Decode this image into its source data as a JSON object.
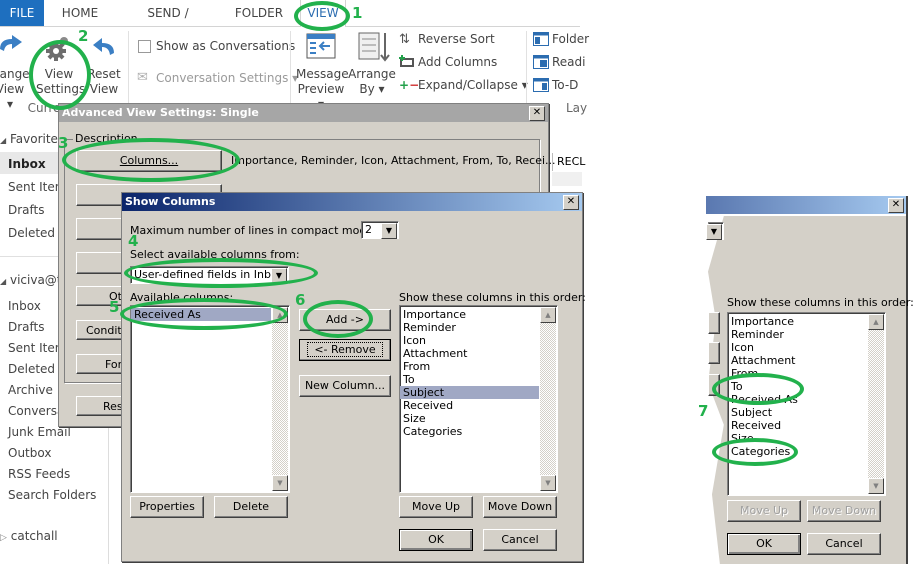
{
  "ribbon": {
    "tabs": [
      "FILE",
      "HOME",
      "SEND / RECEIVE",
      "FOLDER",
      "VIEW"
    ],
    "active_tab": "VIEW",
    "current_view_group": {
      "change_view": [
        "hange",
        "View ▾"
      ],
      "view_settings": [
        "View",
        "Settings"
      ],
      "reset_view": [
        "Reset",
        "View"
      ],
      "group_label": "Curre"
    },
    "messages_group": {
      "show_as_conversations": "Show as Conversations",
      "show_as_conversations_checked": false,
      "conversation_settings": "Conversation Settings ▾"
    },
    "arrangement_group": {
      "message_preview": [
        "Message",
        "Preview ▾"
      ],
      "arrange_by": [
        "Arrange",
        "By ▾"
      ],
      "reverse_sort": "Reverse Sort",
      "add_columns": "Add Columns",
      "expand_collapse": "Expand/Collapse ▾"
    },
    "layout_group": {
      "folder": "Folder",
      "reading": "Readi",
      "todo": "To-D",
      "group_label": "Lay"
    }
  },
  "nav": {
    "favorites_label": "Favorites",
    "favorites": [
      "Inbox",
      "Sent Item",
      "Drafts",
      "Deleted It"
    ],
    "account_label": "viciva@t",
    "account_folders": [
      "Inbox",
      "Drafts",
      "Sent Item",
      "Deleted It",
      "Archive",
      "Conversa",
      "Junk Email",
      "Outbox",
      "RSS Feeds",
      "Search Folders"
    ],
    "other_account": "catchall"
  },
  "message_list": {
    "column_header_partial": "RECL"
  },
  "advanced_view_settings": {
    "title": "Advanced View Settings: Single",
    "description_label": "Description",
    "columns_button": "Columns...",
    "columns_value": "Importance, Reminder, Icon, Attachment, From, To, Recei...",
    "other_button_partial": "Ot",
    "conditional_button_partial": "Condit",
    "format_button_partial": "For",
    "reset_button_partial": "Rese"
  },
  "show_columns": {
    "title": "Show Columns",
    "max_lines_label": "Maximum number of lines in compact mode:",
    "max_lines_value": "2",
    "select_from_label": "Select available columns from:",
    "select_from_value": "User-defined fields in Inbc",
    "available_label": "Available columns:",
    "available_columns": [
      "Received As"
    ],
    "available_selected": "Received As",
    "add_button": "Add ->",
    "remove_button": "<- Remove",
    "new_column_button": "New Column...",
    "properties_button": "Properties",
    "delete_button": "Delete",
    "order_label": "Show these columns in this order:",
    "order_columns": [
      "Importance",
      "Reminder",
      "Icon",
      "Attachment",
      "From",
      "To",
      "Subject",
      "Received",
      "Size",
      "Categories"
    ],
    "order_selected": "Subject",
    "move_up_button": "Move Up",
    "move_down_button": "Move Down",
    "ok_button": "OK",
    "cancel_button": "Cancel"
  },
  "show_columns_after": {
    "order_label": "Show these columns in this order:",
    "order_columns": [
      "Importance",
      "Reminder",
      "Icon",
      "Attachment",
      "From",
      "To",
      "Received As",
      "Subject",
      "Received",
      "Size",
      "Categories"
    ],
    "move_up_button": "Move Up",
    "move_down_button": "Move Down",
    "ok_button": "OK",
    "cancel_button": "Cancel"
  },
  "annotations": {
    "color": "#22b14c",
    "steps": [
      "1",
      "2",
      "3",
      "4",
      "5",
      "6",
      "7"
    ]
  }
}
